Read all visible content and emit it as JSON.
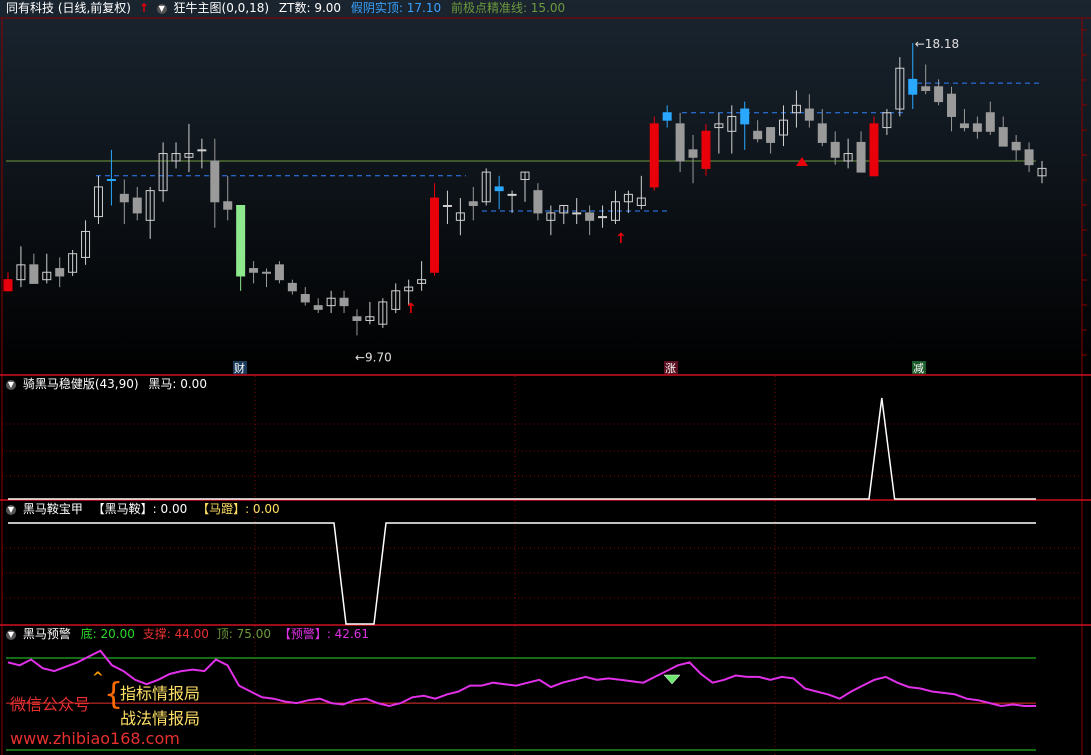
{
  "colors": {
    "up": "#e8000b",
    "down_gray": "#9a9a9a",
    "blue": "#2aa8ff",
    "green": "#8ee88e",
    "grid": "#8b0000",
    "pink": "#e030e8",
    "olive": "#6e9a3c"
  },
  "panel1": {
    "title": "同有科技 (日线,前复权)",
    "indicator": "狂牛主图(0,0,18)",
    "zt_label": "ZT数: 9.00",
    "jiayin_label": "假阴实顶: 17.10",
    "qianjidian_label": "前极点精准线: 15.00",
    "event_badges": [
      "财",
      "涨",
      "减"
    ]
  },
  "panel2": {
    "title": "骑黑马稳健版(43,90)",
    "value_label": "黑马: 0.00"
  },
  "panel3": {
    "title": "黑马鞍宝甲",
    "label1": "【黑马鞍】: 0.00",
    "label2": "【马蹬】: 0.00"
  },
  "panel4": {
    "title": "黑马预警",
    "bottom_label": "底: 20.00",
    "support_label": "支撑: 44.00",
    "top_label": "顶: 75.00",
    "warn_label": "【预警】: 42.61"
  },
  "watermark": {
    "wechat": "微信公众号",
    "line1": "指标情报局",
    "line2": "战法情报局",
    "url": "www.zhibiao168.com"
  },
  "chart_data": {
    "type": "candlestick",
    "price_annotations": {
      "low": "9.70",
      "high": "18.18"
    },
    "candles": [
      {
        "o": 11.8,
        "h": 12.0,
        "l": 11.5,
        "c": 11.5,
        "s": "r"
      },
      {
        "o": 11.8,
        "h": 12.7,
        "l": 11.6,
        "c": 12.2,
        "s": "h"
      },
      {
        "o": 12.2,
        "h": 12.5,
        "l": 11.8,
        "c": 11.7,
        "s": "d"
      },
      {
        "o": 11.8,
        "h": 12.5,
        "l": 11.7,
        "c": 12.0,
        "s": "h"
      },
      {
        "o": 11.9,
        "h": 12.4,
        "l": 11.6,
        "c": 12.1,
        "s": "d"
      },
      {
        "o": 12.0,
        "h": 12.6,
        "l": 11.9,
        "c": 12.5,
        "s": "h"
      },
      {
        "o": 12.4,
        "h": 13.4,
        "l": 12.2,
        "c": 13.1,
        "s": "h"
      },
      {
        "o": 13.5,
        "h": 14.6,
        "l": 13.3,
        "c": 14.3,
        "s": "h"
      },
      {
        "o": 14.5,
        "h": 15.3,
        "l": 13.8,
        "c": 14.5,
        "s": "b"
      },
      {
        "o": 14.1,
        "h": 14.5,
        "l": 13.3,
        "c": 13.9,
        "s": "d"
      },
      {
        "o": 14.0,
        "h": 14.3,
        "l": 13.4,
        "c": 13.6,
        "s": "d"
      },
      {
        "o": 13.4,
        "h": 14.3,
        "l": 12.9,
        "c": 14.2,
        "s": "h"
      },
      {
        "o": 14.2,
        "h": 15.5,
        "l": 13.9,
        "c": 15.2,
        "s": "h"
      },
      {
        "o": 15.2,
        "h": 15.5,
        "l": 14.8,
        "c": 15.0,
        "s": "h"
      },
      {
        "o": 15.2,
        "h": 16.0,
        "l": 14.7,
        "c": 15.1,
        "s": "h"
      },
      {
        "o": 15.3,
        "h": 15.6,
        "l": 14.8,
        "c": 15.3,
        "s": "h"
      },
      {
        "o": 15.0,
        "h": 15.6,
        "l": 13.2,
        "c": 13.9,
        "s": "d"
      },
      {
        "o": 13.7,
        "h": 14.6,
        "l": 13.4,
        "c": 13.9,
        "s": "d"
      },
      {
        "o": 13.8,
        "h": 13.8,
        "l": 11.5,
        "c": 11.9,
        "s": "g"
      },
      {
        "o": 12.0,
        "h": 12.3,
        "l": 11.7,
        "c": 12.1,
        "s": "d"
      },
      {
        "o": 12.0,
        "h": 12.1,
        "l": 11.6,
        "c": 12.0,
        "s": "d"
      },
      {
        "o": 12.2,
        "h": 12.3,
        "l": 11.7,
        "c": 11.8,
        "s": "d"
      },
      {
        "o": 11.7,
        "h": 11.8,
        "l": 11.4,
        "c": 11.5,
        "s": "d"
      },
      {
        "o": 11.4,
        "h": 11.6,
        "l": 11.1,
        "c": 11.2,
        "s": "d"
      },
      {
        "o": 11.1,
        "h": 11.3,
        "l": 10.9,
        "c": 11.0,
        "s": "d"
      },
      {
        "o": 11.1,
        "h": 11.5,
        "l": 10.9,
        "c": 11.3,
        "s": "h"
      },
      {
        "o": 11.3,
        "h": 11.5,
        "l": 10.9,
        "c": 11.1,
        "s": "d"
      },
      {
        "o": 10.8,
        "h": 11.0,
        "l": 10.3,
        "c": 10.7,
        "s": "d"
      },
      {
        "o": 10.8,
        "h": 11.2,
        "l": 10.6,
        "c": 10.7,
        "s": "h"
      },
      {
        "o": 10.6,
        "h": 11.3,
        "l": 10.5,
        "c": 11.2,
        "s": "h"
      },
      {
        "o": 11.0,
        "h": 11.7,
        "l": 10.9,
        "c": 11.5,
        "s": "h"
      },
      {
        "o": 11.5,
        "h": 11.8,
        "l": 11.1,
        "c": 11.6,
        "s": "h"
      },
      {
        "o": 11.8,
        "h": 12.3,
        "l": 11.5,
        "c": 11.7,
        "s": "h"
      },
      {
        "o": 12.0,
        "h": 14.4,
        "l": 11.9,
        "c": 14.0,
        "s": "r"
      },
      {
        "o": 13.8,
        "h": 14.2,
        "l": 13.3,
        "c": 13.8,
        "s": "h"
      },
      {
        "o": 13.4,
        "h": 14.0,
        "l": 13.0,
        "c": 13.6,
        "s": "h"
      },
      {
        "o": 13.8,
        "h": 14.3,
        "l": 13.4,
        "c": 13.9,
        "s": "d"
      },
      {
        "o": 13.9,
        "h": 14.8,
        "l": 13.8,
        "c": 14.7,
        "s": "h"
      },
      {
        "o": 14.3,
        "h": 14.6,
        "l": 13.7,
        "c": 14.2,
        "s": "b"
      },
      {
        "o": 14.1,
        "h": 14.2,
        "l": 13.6,
        "c": 14.1,
        "s": "h"
      },
      {
        "o": 14.5,
        "h": 14.7,
        "l": 13.9,
        "c": 14.7,
        "s": "h"
      },
      {
        "o": 14.2,
        "h": 14.4,
        "l": 13.4,
        "c": 13.6,
        "s": "d"
      },
      {
        "o": 13.4,
        "h": 13.8,
        "l": 13.0,
        "c": 13.6,
        "s": "h"
      },
      {
        "o": 13.6,
        "h": 13.8,
        "l": 13.3,
        "c": 13.8,
        "s": "h"
      },
      {
        "o": 13.6,
        "h": 14.0,
        "l": 13.3,
        "c": 13.6,
        "s": "h"
      },
      {
        "o": 13.6,
        "h": 13.8,
        "l": 13.0,
        "c": 13.4,
        "s": "d"
      },
      {
        "o": 13.5,
        "h": 13.8,
        "l": 13.2,
        "c": 13.5,
        "s": "h"
      },
      {
        "o": 13.4,
        "h": 14.2,
        "l": 13.3,
        "c": 13.9,
        "s": "h"
      },
      {
        "o": 13.9,
        "h": 14.2,
        "l": 13.6,
        "c": 14.1,
        "s": "h"
      },
      {
        "o": 13.8,
        "h": 14.6,
        "l": 13.7,
        "c": 14.0,
        "s": "h"
      },
      {
        "o": 14.3,
        "h": 16.2,
        "l": 14.2,
        "c": 16.0,
        "s": "r"
      },
      {
        "o": 16.1,
        "h": 16.5,
        "l": 15.9,
        "c": 16.3,
        "s": "b"
      },
      {
        "o": 16.0,
        "h": 16.3,
        "l": 14.7,
        "c": 15.0,
        "s": "d"
      },
      {
        "o": 15.1,
        "h": 15.7,
        "l": 14.4,
        "c": 15.3,
        "s": "d"
      },
      {
        "o": 14.8,
        "h": 16.0,
        "l": 14.6,
        "c": 15.8,
        "s": "r"
      },
      {
        "o": 15.9,
        "h": 16.3,
        "l": 15.2,
        "c": 16.0,
        "s": "h"
      },
      {
        "o": 15.8,
        "h": 16.5,
        "l": 15.2,
        "c": 16.2,
        "s": "h"
      },
      {
        "o": 16.4,
        "h": 16.6,
        "l": 15.3,
        "c": 16.0,
        "s": "b"
      },
      {
        "o": 15.8,
        "h": 16.1,
        "l": 15.5,
        "c": 15.6,
        "s": "d"
      },
      {
        "o": 15.9,
        "h": 15.9,
        "l": 15.2,
        "c": 15.5,
        "s": "d"
      },
      {
        "o": 15.7,
        "h": 16.5,
        "l": 15.4,
        "c": 16.1,
        "s": "h"
      },
      {
        "o": 16.3,
        "h": 16.9,
        "l": 15.9,
        "c": 16.5,
        "s": "h"
      },
      {
        "o": 16.4,
        "h": 16.8,
        "l": 15.9,
        "c": 16.1,
        "s": "d"
      },
      {
        "o": 16.0,
        "h": 16.4,
        "l": 15.4,
        "c": 15.5,
        "s": "d"
      },
      {
        "o": 15.5,
        "h": 15.8,
        "l": 14.9,
        "c": 15.1,
        "s": "d"
      },
      {
        "o": 15.0,
        "h": 15.6,
        "l": 14.8,
        "c": 15.2,
        "s": "h"
      },
      {
        "o": 15.5,
        "h": 15.8,
        "l": 14.7,
        "c": 14.7,
        "s": "d"
      },
      {
        "o": 14.6,
        "h": 16.2,
        "l": 14.6,
        "c": 16.0,
        "s": "r"
      },
      {
        "o": 15.9,
        "h": 16.4,
        "l": 15.7,
        "c": 16.3,
        "s": "h"
      },
      {
        "o": 16.4,
        "h": 17.8,
        "l": 16.2,
        "c": 17.5,
        "s": "h"
      },
      {
        "o": 17.2,
        "h": 18.18,
        "l": 16.4,
        "c": 16.8,
        "s": "b"
      },
      {
        "o": 17.0,
        "h": 17.6,
        "l": 16.8,
        "c": 16.9,
        "s": "d"
      },
      {
        "o": 17.0,
        "h": 17.2,
        "l": 16.5,
        "c": 16.6,
        "s": "d"
      },
      {
        "o": 16.8,
        "h": 17.0,
        "l": 15.8,
        "c": 16.2,
        "s": "d"
      },
      {
        "o": 16.0,
        "h": 16.4,
        "l": 15.8,
        "c": 15.9,
        "s": "d"
      },
      {
        "o": 16.0,
        "h": 16.2,
        "l": 15.6,
        "c": 15.8,
        "s": "d"
      },
      {
        "o": 16.3,
        "h": 16.6,
        "l": 15.7,
        "c": 15.8,
        "s": "d"
      },
      {
        "o": 15.9,
        "h": 16.2,
        "l": 15.4,
        "c": 15.4,
        "s": "d"
      },
      {
        "o": 15.5,
        "h": 15.7,
        "l": 15.0,
        "c": 15.3,
        "s": "d"
      },
      {
        "o": 15.3,
        "h": 15.5,
        "l": 14.7,
        "c": 14.9,
        "s": "d"
      },
      {
        "o": 14.8,
        "h": 15.0,
        "l": 14.4,
        "c": 14.6,
        "s": "h"
      }
    ],
    "panel2_series": [
      0,
      0,
      0,
      0,
      0,
      0,
      0,
      0,
      0,
      0,
      0,
      0,
      0,
      0,
      0,
      0,
      0,
      0,
      0,
      0,
      0,
      0,
      0,
      0,
      0,
      0,
      0,
      0,
      0,
      0,
      0,
      0,
      0,
      0,
      0,
      0,
      0,
      0,
      0,
      0,
      0,
      0,
      0,
      0,
      0,
      0,
      0,
      0,
      0,
      0,
      0,
      0,
      0,
      0,
      0,
      0,
      0,
      0,
      0,
      0,
      0,
      0,
      0,
      0,
      0,
      0,
      0,
      0,
      1,
      0,
      0,
      0,
      0,
      0,
      0,
      0,
      0,
      0,
      0,
      0,
      0
    ],
    "panel4_series": [
      72,
      70,
      74,
      68,
      66,
      69,
      72,
      76,
      80,
      70,
      66,
      60,
      57,
      60,
      64,
      66,
      67,
      66,
      74,
      70,
      56,
      52,
      48,
      47,
      45,
      44,
      46,
      47,
      44,
      43,
      46,
      47,
      44,
      42,
      44,
      48,
      49,
      47,
      50,
      52,
      56,
      56,
      58,
      57,
      56,
      58,
      60,
      55,
      58,
      60,
      62,
      60,
      61,
      60,
      59,
      58,
      62,
      66,
      70,
      72,
      64,
      58,
      60,
      63,
      62,
      62,
      60,
      62,
      61,
      54,
      52,
      50,
      47,
      52,
      56,
      60,
      62,
      58,
      55,
      54,
      52,
      51,
      50,
      47,
      46,
      44,
      42,
      43,
      42,
      42
    ]
  }
}
